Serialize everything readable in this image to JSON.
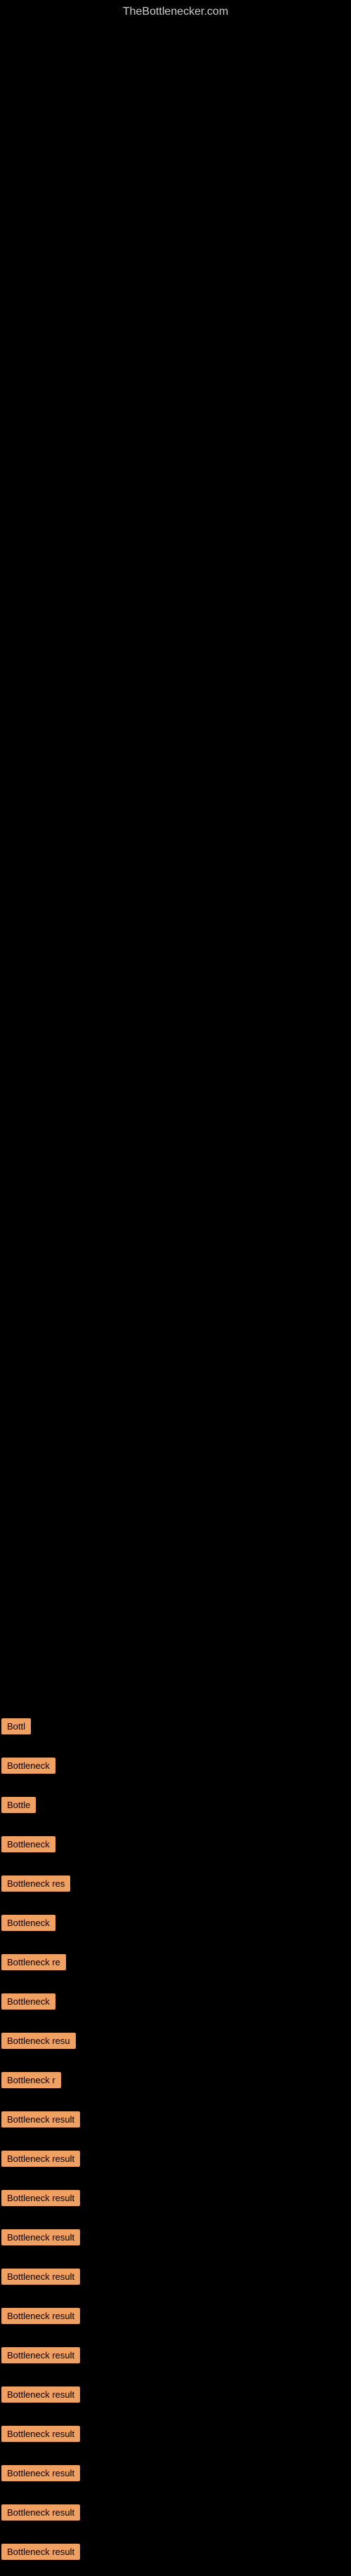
{
  "header": {
    "site_title": "TheBottlenecker.com"
  },
  "items": [
    {
      "label": "Bottl",
      "width": 45
    },
    {
      "label": "Bottleneck",
      "width": 80
    },
    {
      "label": "Bottle",
      "width": 52
    },
    {
      "label": "Bottleneck",
      "width": 80
    },
    {
      "label": "Bottleneck res",
      "width": 110
    },
    {
      "label": "Bottleneck",
      "width": 80
    },
    {
      "label": "Bottleneck re",
      "width": 100
    },
    {
      "label": "Bottleneck",
      "width": 80
    },
    {
      "label": "Bottleneck resu",
      "width": 115
    },
    {
      "label": "Bottleneck r",
      "width": 88
    },
    {
      "label": "Bottleneck result",
      "width": 130
    },
    {
      "label": "Bottleneck result",
      "width": 130
    },
    {
      "label": "Bottleneck result",
      "width": 130
    },
    {
      "label": "Bottleneck result",
      "width": 130
    },
    {
      "label": "Bottleneck result",
      "width": 130
    },
    {
      "label": "Bottleneck result",
      "width": 130
    },
    {
      "label": "Bottleneck result",
      "width": 130
    },
    {
      "label": "Bottleneck result",
      "width": 130
    },
    {
      "label": "Bottleneck result",
      "width": 130
    },
    {
      "label": "Bottleneck result",
      "width": 130
    },
    {
      "label": "Bottleneck result",
      "width": 130
    },
    {
      "label": "Bottleneck result",
      "width": 130
    }
  ]
}
